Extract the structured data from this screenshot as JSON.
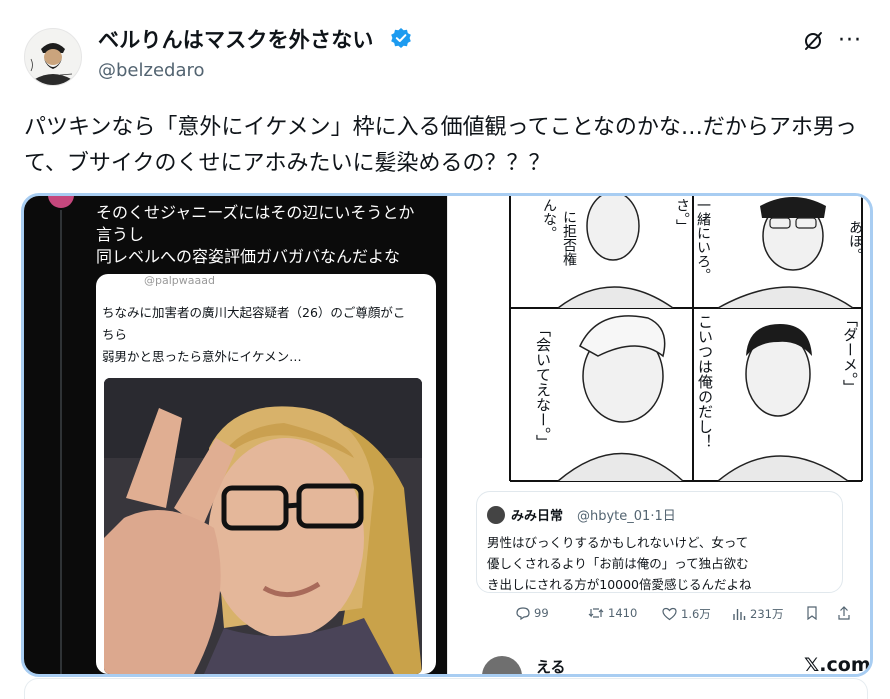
{
  "author": {
    "display_name": "ベルりんはマスクを外さない",
    "handle": "@belzedaro",
    "verified": true,
    "avatar_icon": "bearded-man-sketch-icon"
  },
  "header_actions": {
    "grok_icon": "grok-icon",
    "more_label": "···"
  },
  "tweet": {
    "text": "パツキンなら「意外にイケメン」枠に入る価値観ってことなのかな…だからアホ男って、ブサイクのくせにアホみたいに髪染めるの？？？"
  },
  "media": {
    "left": {
      "dark_text": "そのくせジャニーズにはその辺にいそうとか\n言うし\n同レベルへの容姿評価ガバガバなんだよな",
      "inner_handle": "@palpwaaad",
      "inner_text": "ちなみに加害者の廣川大起容疑者（26）のご尊顔がこ\nちら\n弱男かと思ったら意外にイケメン…"
    },
    "right": {
      "manga_lines": [
        "さ。」",
        "一緒にいろ。",
        "あほ。",
        "に拒否権",
        "んな。",
        "「会いてえなー。」",
        "こいつは俺のだし！",
        "「ダーメ。」"
      ],
      "quote": {
        "name": "みみ日常",
        "handle_time": "@hbyte_01·1日",
        "text": "男性はびっくりするかもしれないけど、女って\n優しくされるより「お前は俺の」って独占欲む\nき出しにされる方が10000倍愛感じるんだよね"
      },
      "actions": {
        "reply": "99",
        "retweet": "1410",
        "like": "1.6万",
        "views": "231万"
      },
      "next_tweet_name": "える",
      "watermark": "𝕏.com"
    }
  },
  "colors": {
    "accent": "#1d9bf0",
    "media_border": "#a8cdf2",
    "muted": "#536471"
  }
}
